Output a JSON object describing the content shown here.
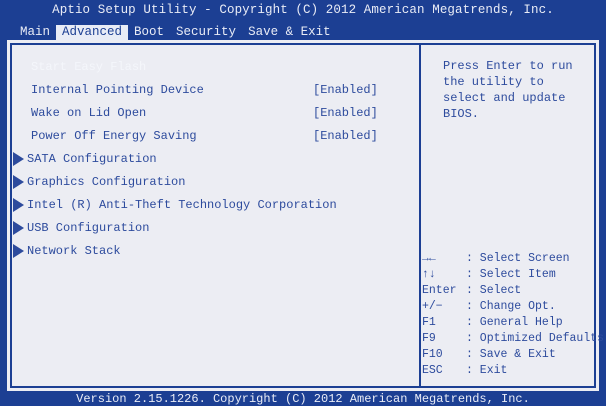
{
  "title": "Aptio Setup Utility - Copyright (C) 2012 American Megatrends, Inc.",
  "tabs": [
    {
      "label": "Main",
      "active": false
    },
    {
      "label": "Advanced",
      "active": true
    },
    {
      "label": "Boot",
      "active": false
    },
    {
      "label": "Security",
      "active": false
    },
    {
      "label": "Save & Exit",
      "active": false
    }
  ],
  "items": [
    {
      "label": "Start Easy Flash",
      "value": "",
      "highlighted": true
    },
    {
      "label": "Internal Pointing Device",
      "value": "[Enabled]"
    },
    {
      "label": "Wake on Lid Open",
      "value": "[Enabled]"
    },
    {
      "label": "Power Off Energy Saving",
      "value": "[Enabled]"
    }
  ],
  "submenus": [
    {
      "label": "SATA Configuration"
    },
    {
      "label": "Graphics Configuration"
    },
    {
      "label": "Intel (R) Anti-Theft Technology Corporation"
    },
    {
      "label": "USB Configuration"
    },
    {
      "label": "Network Stack"
    }
  ],
  "help_text": "Press Enter to run\nthe utility to\nselect and update\nBIOS.",
  "keys": [
    {
      "key": "→←",
      "desc": ": Select Screen"
    },
    {
      "key": "↑↓",
      "desc": ": Select Item"
    },
    {
      "key": "Enter",
      "desc": ": Select"
    },
    {
      "key": "+/−",
      "desc": ": Change Opt."
    },
    {
      "key": "F1",
      "desc": ": General Help"
    },
    {
      "key": "F9",
      "desc": ": Optimized Defaults"
    },
    {
      "key": "F10",
      "desc": ": Save & Exit"
    },
    {
      "key": "ESC",
      "desc": ": Exit"
    }
  ],
  "footer": "Version 2.15.1226. Copyright (C) 2012 American Megatrends, Inc.",
  "colors": {
    "background": "#1c3f93",
    "panel": "#ecedf3",
    "text": "#2d4b9d"
  }
}
